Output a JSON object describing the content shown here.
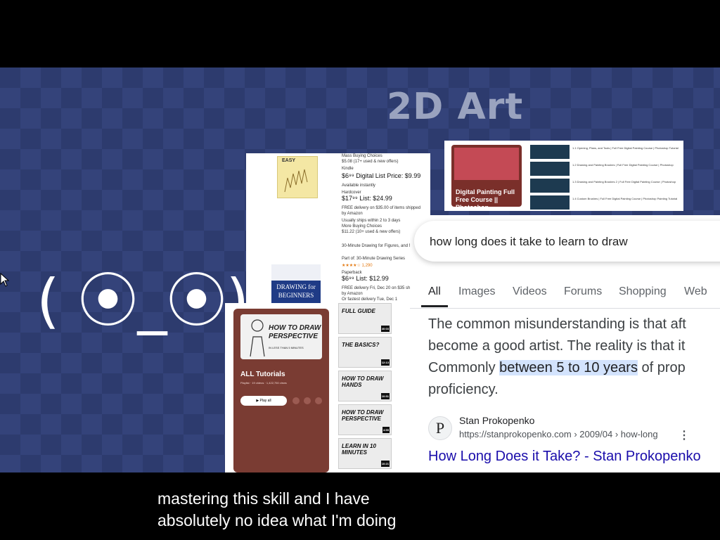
{
  "slide": {
    "title": "2D Art",
    "face": "( ⦿_⦿)"
  },
  "amazon": {
    "rows": [
      {
        "text": "Mass Buying Choices"
      },
      {
        "text": "$5.08 (17+ used & new offers)"
      },
      {
        "text": "Kindle"
      },
      {
        "text": "$6⁹⁹  Digital List Price: $9.99"
      },
      {
        "text": "Available instantly"
      },
      {
        "text": "Hardcover"
      },
      {
        "text": "$17⁹⁹  List: $24.99"
      },
      {
        "text": "FREE delivery on $35.00 of items shipped by Amazon"
      },
      {
        "text": "Usually ships within 2 to 3 days"
      },
      {
        "text": "More Buying Choices"
      },
      {
        "text": "$11.22 (10+ used & new offers)"
      }
    ],
    "book2_title": "30-Minute Drawing for Figures, and More",
    "book2_meta": "Part of: 30-Minute Drawing Series",
    "book2_rating": "★★★★☆ 1,290",
    "book2_format": "Paperback",
    "book2_price": "$6⁹⁹  List: $12.99",
    "book2_delivery": "FREE delivery Fri, Dec 20 on $35 shipped by Amazon",
    "book2_delivery2": "Or fastest delivery Tue, Dec 1",
    "book1_cover": "EASY",
    "book2_cover": "DRAWING for BEGINNERS"
  },
  "yt_top": {
    "thumb_title": "Digital Painting Full Free Course || Photoshop ...",
    "rows": [
      "1.1 Opening, Plans, and Tools | Full Free Digital Painting Course | Photoshop Tutorial",
      "1.2 Drawing and Painting Brushes | Full Free Digital Painting Course | Photoshop",
      "1.3 Drawing and Painting Brushes 2 | Full Free Digital Painting Course | Photoshop",
      "1.4 Custom Brushes | Full Free Digital Painting Course | Photoshop Painting Tutorial"
    ]
  },
  "yt_list": {
    "cover_text": "HOW TO DRAW PERSPECTIVE",
    "cover_sub": "IN LESS THAN 5 MINUTES",
    "name": "ALL Tutorials",
    "meta": "Playlist · 19 videos · 1,422,750 views",
    "play_label": "Play all",
    "items": [
      {
        "label": "FULL GUIDE",
        "dur": "40:03"
      },
      {
        "label": "THE BASICS?",
        "dur": "12:13"
      },
      {
        "label": "HOW TO DRAW HANDS",
        "dur": "10:51"
      },
      {
        "label": "HOW TO DRAW PERSPECTIVE",
        "dur": "4:55"
      },
      {
        "label": "LEARN IN 10 MINUTES",
        "dur": "10:21"
      }
    ]
  },
  "google": {
    "query": "how long does it take to learn to draw",
    "tabs": [
      "All",
      "Images",
      "Videos",
      "Forums",
      "Shopping",
      "Web"
    ],
    "snippet_line1": "The common misunderstanding is that aft",
    "snippet_line2": "become a good artist. The reality is that it",
    "snippet_line3_pre": "Commonly ",
    "snippet_line3_hl": "between 5 to 10 years",
    "snippet_line3_post": " of prop",
    "snippet_line4": "proficiency.",
    "source_icon": "P",
    "source_name": "Stan Prokopenko",
    "source_url": "https://stanprokopenko.com › 2009/04 › how-long",
    "result_title": "How Long Does it Take? - Stan Prokopenko"
  },
  "caption": {
    "line1": "mastering this skill and I have",
    "line2": "absolutely no idea what I'm doing"
  },
  "colors": {
    "background": "#2d3b6e",
    "highlight": "#d3e3fd",
    "link": "#1a0dab"
  }
}
